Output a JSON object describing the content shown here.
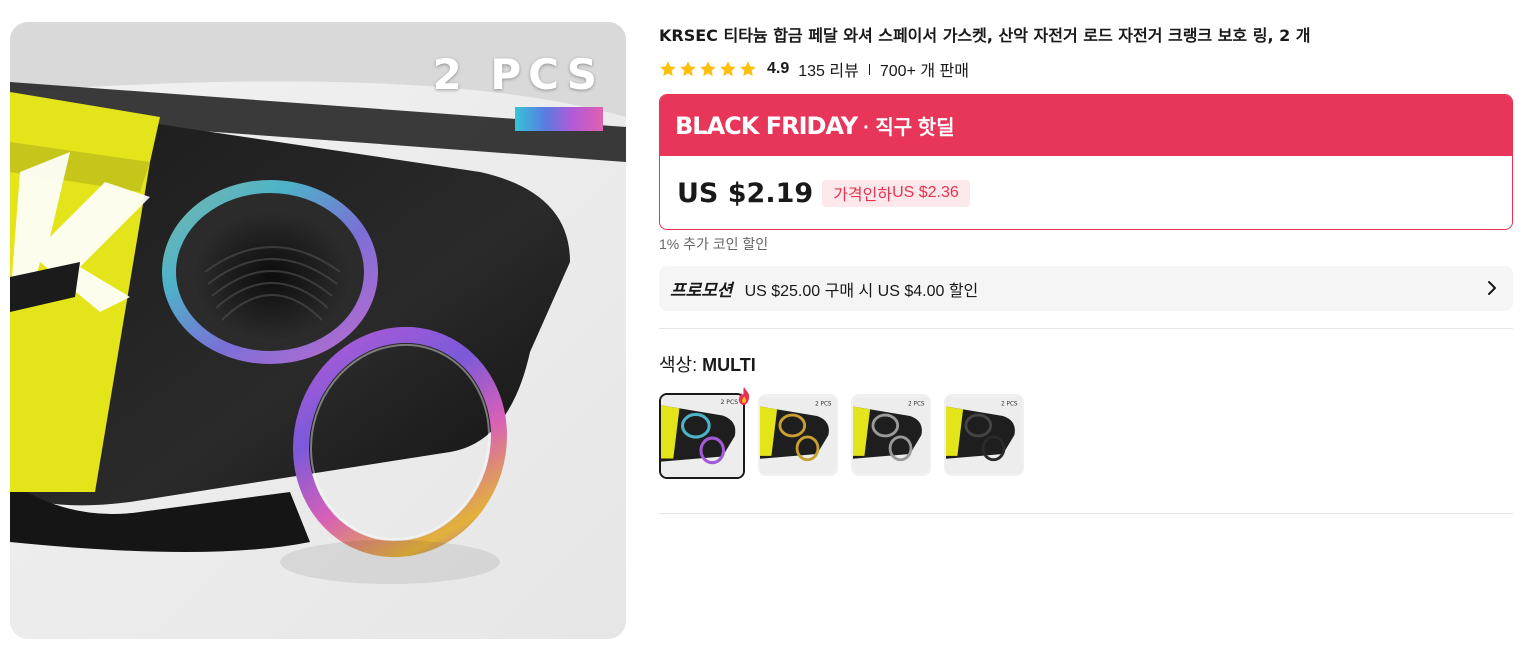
{
  "product": {
    "title": "KRSEC 티타늄 합금 페달 와셔 스페이서 가스켓, 산악 자전거 로드 자전거 크랭크 보호 링, 2 개",
    "image_badge": "2 PCS",
    "rating": "4.9",
    "rating_fraction": 0.98,
    "review_count": "135 리뷰",
    "sold": "700+ 개 판매"
  },
  "deal": {
    "event": "BLACK FRIDAY",
    "event_sub": "· 직구 핫딜",
    "price": "US $2.19",
    "discount_label": "가격인하",
    "original_price": "US $2.36",
    "coin_note": "1% 추가 코인 할인"
  },
  "promotion": {
    "badge": "프로모션",
    "text": "US $25.00 구매 시 US $4.00 할인"
  },
  "color": {
    "label": "색상: ",
    "selected": "MULTI",
    "options": [
      "multi",
      "gold",
      "silver",
      "black"
    ]
  },
  "colors": {
    "accent": "#e8365a",
    "star": "#fcc00c",
    "ring_multi": "#a35ad6",
    "ring_gold": "#c9a030",
    "ring_silver": "#9a9a9a",
    "ring_black": "#2a2a2a"
  },
  "icons": {
    "stars": "star-icon",
    "promo_arrow": "chevron-right-icon",
    "hot": "flame-icon"
  }
}
